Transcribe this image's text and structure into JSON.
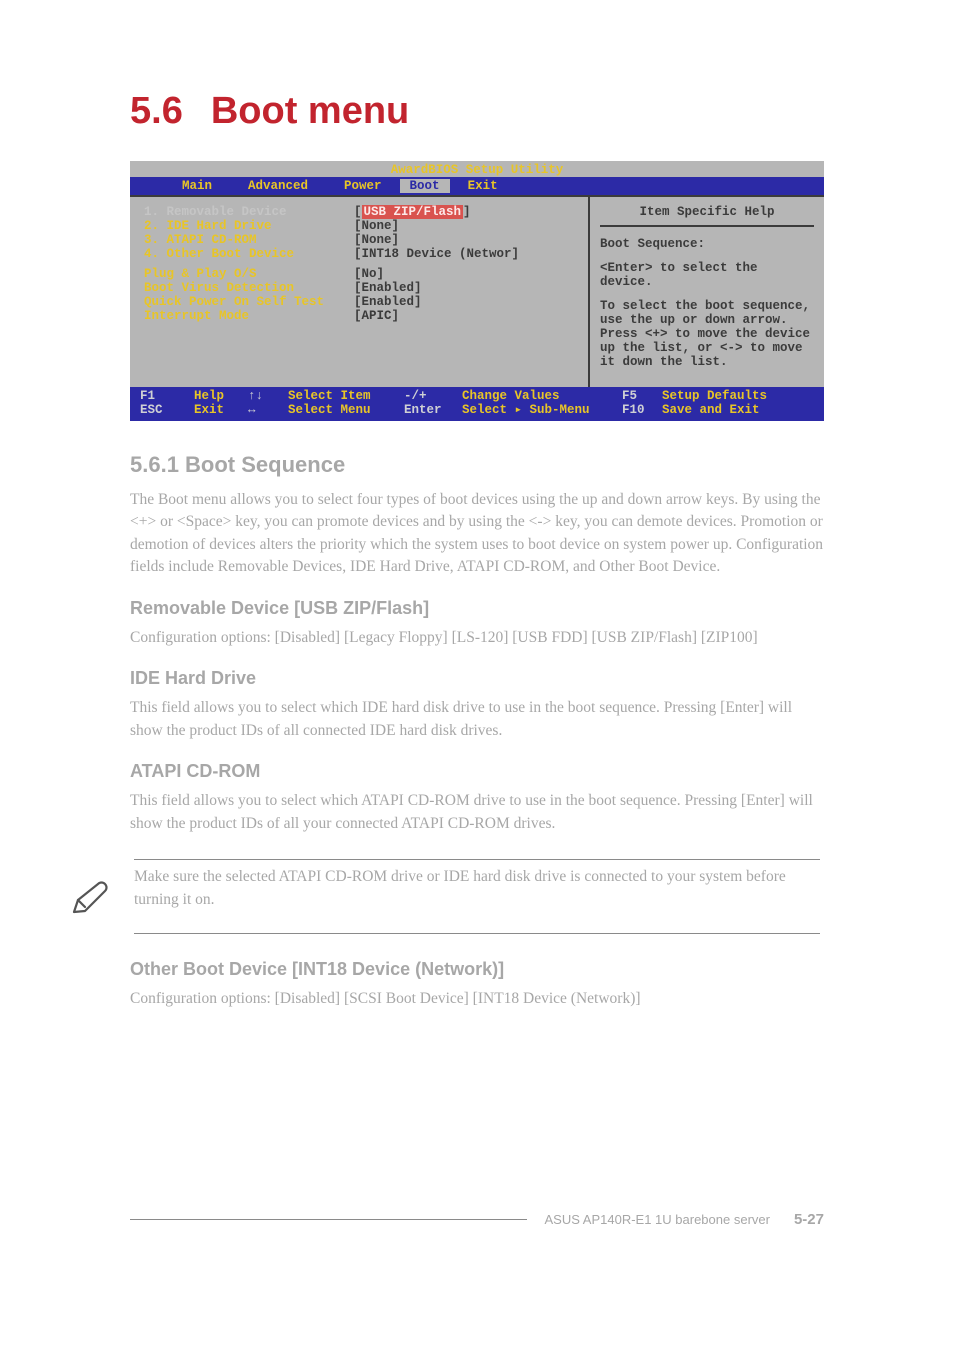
{
  "heading": {
    "number": "5.6",
    "title": "Boot menu"
  },
  "bios": {
    "title": "AwardBIOS Setup Utility",
    "tabs": [
      "Main",
      "Advanced",
      "Power",
      "Boot",
      "Exit"
    ],
    "active_tab": "Boot",
    "rows": [
      {
        "key": "1. Removable Device",
        "style": "g",
        "val": "[",
        "hl": "USB ZIP/Flash",
        "post": "]"
      },
      {
        "key": "2. IDE Hard Drive",
        "style": "y",
        "val": "[None]"
      },
      {
        "key": "3. ATAPI CD-ROM",
        "style": "y",
        "val": "[None]"
      },
      {
        "key": "4. Other Boot Device",
        "style": "y",
        "val": "[INT18 Device (Networ]"
      },
      {
        "gap": true
      },
      {
        "key": "Plug & Play O/S",
        "style": "y",
        "val": "[No]"
      },
      {
        "key": "Boot Virus Detection",
        "style": "y",
        "val": "[Enabled]"
      },
      {
        "key": "Quick Power On Self Test",
        "style": "y",
        "val": "[Enabled]"
      },
      {
        "key": "Interrupt Mode",
        "style": "y",
        "val": "[APIC]"
      }
    ],
    "help": {
      "title": "Item Specific Help",
      "p1": "Boot Sequence:",
      "p2": "<Enter> to select the device.",
      "p3": "To select the boot sequence, use the up or down arrow. Press <+> to move the device up the list, or <-> to move it down the list."
    },
    "footer": {
      "r1": {
        "c1k": "F1",
        "c1t": "Help",
        "c3": "↑↓",
        "c4": "Select Item",
        "c5": "-/+",
        "c6": "Change Values",
        "c7k": "F5",
        "c8": "Setup Defaults"
      },
      "r2": {
        "c1k": "ESC",
        "c1t": "Exit",
        "c3": "↔",
        "c4": "Select Menu",
        "c5": "Enter",
        "c6": "Select ▸ Sub-Menu",
        "c7k": "F10",
        "c8": "Save and Exit"
      }
    }
  },
  "body": {
    "h2": "5.6.1 Boot Sequence",
    "p1": "The Boot menu allows you to select four types of boot devices using the up and down arrow keys. By using the <+> or <Space> key, you can promote devices and by using the <-> key, you can demote devices. Promotion or demotion of devices alters the priority which the system uses to boot device on system power up. Configuration fields include Removable Devices, IDE Hard Drive, ATAPI CD-ROM, and Other Boot Device.",
    "h3a": "Removable Device [USB ZIP/Flash]",
    "p2": "Configuration options: [Disabled] [Legacy Floppy] [LS-120] [USB FDD] [USB ZIP/Flash] [ZIP100]",
    "h3b": "IDE Hard Drive",
    "p3": "This field allows you to select which IDE hard disk drive to use in the boot sequence. Pressing [Enter] will show the product IDs of all connected IDE hard disk drives.",
    "h3c": "ATAPI CD-ROM",
    "p4": "This field allows you to select which ATAPI CD-ROM drive to use in the boot sequence. Pressing [Enter] will show the product IDs of all your connected ATAPI CD-ROM drives.",
    "note": "Make sure the selected ATAPI CD-ROM drive or IDE hard disk drive is connected to your system before turning it on.",
    "h3d": "Other Boot Device [INT18 Device (Network)]",
    "p5": "Configuration options: [Disabled] [SCSI Boot Device] [INT18 Device (Network)]"
  },
  "pagefooter": {
    "label": "ASUS AP140R-E1 1U barebone server",
    "page": "5-27"
  }
}
